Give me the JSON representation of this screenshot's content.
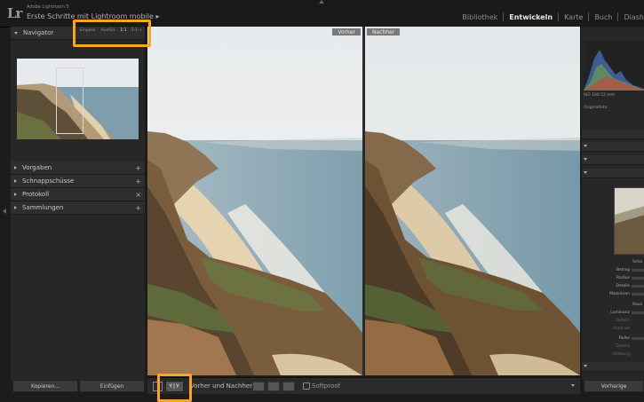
{
  "app": {
    "logo": "Lr",
    "name": "Adobe Lightroom 5",
    "catalog": "Erste Schritte mit Lightroom mobile ▸"
  },
  "modules": [
    {
      "label": "Bibliothek",
      "active": false
    },
    {
      "label": "Entwickeln",
      "active": true
    },
    {
      "label": "Karte",
      "active": false
    },
    {
      "label": "Buch",
      "active": false
    },
    {
      "label": "Diash",
      "active": false
    }
  ],
  "left_panel": {
    "navigator": {
      "title": "Navigator",
      "zoom_options": [
        {
          "label": "Einpass.",
          "active": false
        },
        {
          "label": "Ausfüll.",
          "active": false
        },
        {
          "label": "1:1",
          "active": true
        },
        {
          "label": "3:1 ÷",
          "active": false
        }
      ]
    },
    "sections": [
      {
        "label": "Vorgaben",
        "control": "+"
      },
      {
        "label": "Schnappschüsse",
        "control": "+"
      },
      {
        "label": "Protokoll",
        "control": "×"
      },
      {
        "label": "Sammlungen",
        "control": "+"
      }
    ],
    "buttons": {
      "copy": "Kopieren...",
      "paste": "Einfügen"
    }
  },
  "compare": {
    "before_label": "Vorher",
    "after_label": "Nachher"
  },
  "toolbar": {
    "view_icon_label": "Y|Y",
    "mode_label": "Vorher und Nachher:",
    "softproof_label": "Softproof",
    "softproof_checked": false
  },
  "right_panel": {
    "hist_info": "ISO 100      52 mm",
    "original_label": "Originalfoto",
    "labels": [
      "Scha",
      "Betrag",
      "Radius",
      "Details",
      "Maskieren",
      "Raus",
      "Luminanz",
      "Details",
      "Kontrast",
      "Farbe",
      "Details",
      "Glättung"
    ],
    "button": "Vorherige"
  },
  "colors": {
    "highlight": "#f5a623",
    "active_module": "#e8e8e8"
  }
}
